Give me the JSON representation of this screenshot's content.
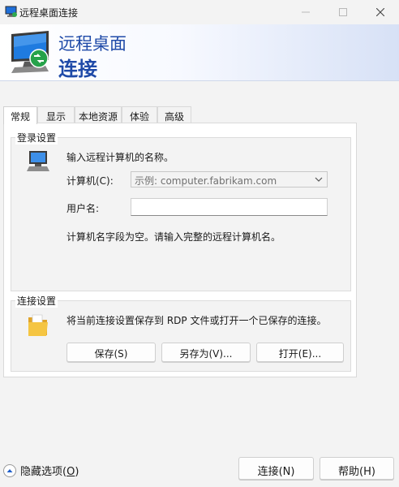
{
  "window": {
    "title": "远程桌面连接"
  },
  "banner": {
    "line1": "远程桌面",
    "line2": "连接"
  },
  "tabs": [
    {
      "label": "常规",
      "active": true
    },
    {
      "label": "显示",
      "active": false
    },
    {
      "label": "本地资源",
      "active": false
    },
    {
      "label": "体验",
      "active": false
    },
    {
      "label": "高级",
      "active": false
    }
  ],
  "login": {
    "group_title": "登录设置",
    "instruction": "输入远程计算机的名称。",
    "computer_label": "计算机(C):",
    "computer_placeholder": "示例: computer.fabrikam.com",
    "username_label": "用户名:",
    "username_value": "",
    "hint": "计算机名字段为空。请输入完整的远程计算机名。"
  },
  "connection": {
    "group_title": "连接设置",
    "description": "将当前连接设置保存到 RDP 文件或打开一个已保存的连接。",
    "save_label": "保存(S)",
    "save_as_label": "另存为(V)...",
    "open_label": "打开(E)..."
  },
  "footer": {
    "hide_options_label": "隐藏选项(",
    "hide_options_key": "O",
    "hide_options_suffix": ")",
    "connect_label": "连接(N)",
    "help_label": "帮助(H)"
  },
  "colors": {
    "accent": "#1f4aa8",
    "background": "#f3f3f3"
  },
  "icons": {
    "app": "remote-desktop-icon",
    "banner": "remote-desktop-monitor-icon",
    "login": "computer-icon",
    "connection": "folder-icon",
    "footer": "collapse-up-icon",
    "combo": "chevron-down-icon"
  }
}
